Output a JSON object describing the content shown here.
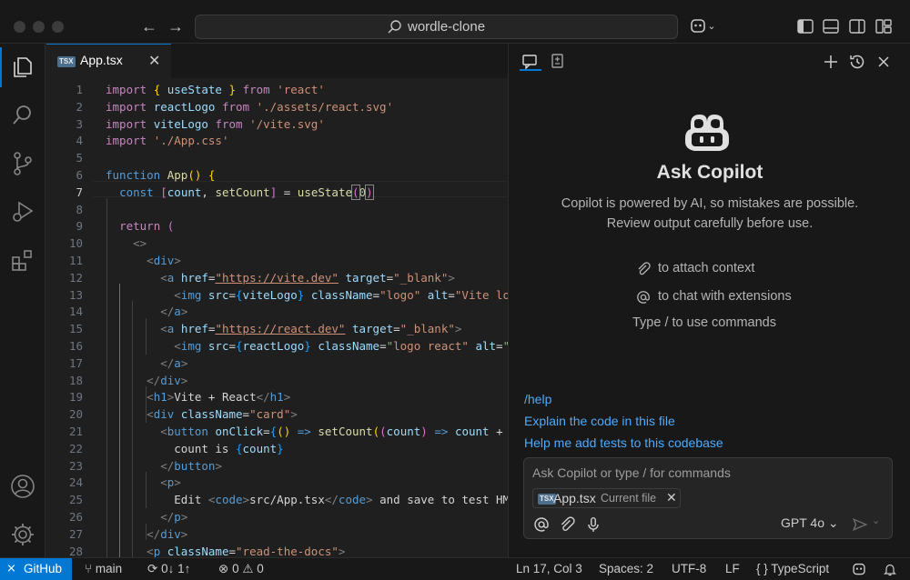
{
  "window": {
    "search_text": "wordle-clone"
  },
  "editor": {
    "tab": {
      "label": "App.tsx",
      "badge": "TSX"
    },
    "current_line": 7
  },
  "chat": {
    "title": "Ask Copilot",
    "description": "Copilot is powered by AI, so mistakes are possible. Review output carefully before use.",
    "hints": [
      {
        "icon": "paperclip-icon",
        "text": "to attach context"
      },
      {
        "icon": "at-icon",
        "text": "to chat with extensions"
      },
      {
        "icon": "",
        "text": "Type / to use commands"
      }
    ],
    "suggestions": [
      "/help",
      "Explain the code in this file",
      "Help me add tests to this codebase"
    ],
    "input": {
      "placeholder": "Ask Copilot or type / for commands",
      "context_file": "App.tsx",
      "context_label": "Current file",
      "model": "GPT 4o"
    }
  },
  "statusbar": {
    "remote": "GitHub",
    "branch": "main",
    "sync": "0↓ 1↑",
    "errors": "0",
    "warnings": "0",
    "position": "Ln 17, Col 3",
    "spaces": "Spaces: 2",
    "encoding": "UTF-8",
    "eol": "LF",
    "language": "TypeScript"
  },
  "colors": {
    "accent": "#0078d4",
    "link": "#4daafc"
  }
}
